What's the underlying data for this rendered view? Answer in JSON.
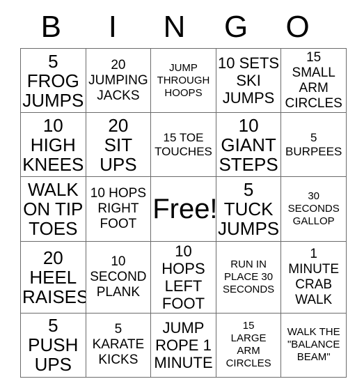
{
  "card": {
    "title": "BINGO",
    "header_letters": [
      "B",
      "I",
      "N",
      "G",
      "O"
    ],
    "free_space_label": "Free!",
    "grid_line_color": "#6b6b6b",
    "text_color": "#000000",
    "background_color": "#ffffff"
  },
  "cells": [
    [
      {
        "lines": [
          "5",
          "FROG",
          "JUMPS"
        ],
        "size": "s26"
      },
      {
        "lines": [
          "20",
          "JUMPING",
          "JACKS"
        ],
        "size": "s19"
      },
      {
        "lines": [
          "JUMP",
          "THROUGH",
          "HOOPS"
        ],
        "size": "s15"
      },
      {
        "lines": [
          "10 SETS",
          "SKI",
          "JUMPS"
        ],
        "size": "s22"
      },
      {
        "lines": [
          "15 SMALL",
          "ARM",
          "CIRCLES"
        ],
        "size": "s19"
      }
    ],
    [
      {
        "lines": [
          "10",
          "HIGH",
          "KNEES"
        ],
        "size": "s26"
      },
      {
        "lines": [
          "20",
          "SIT",
          "UPS"
        ],
        "size": "s26"
      },
      {
        "lines": [
          "15 TOE",
          "TOUCHES"
        ],
        "size": "s17"
      },
      {
        "lines": [
          "10",
          "GIANT",
          "STEPS"
        ],
        "size": "s26"
      },
      {
        "lines": [
          "5",
          "BURPEES"
        ],
        "size": "s17"
      }
    ],
    [
      {
        "lines": [
          "WALK",
          "ON TIP",
          "TOES"
        ],
        "size": "s26"
      },
      {
        "lines": [
          "10 HOPS",
          "RIGHT",
          "FOOT"
        ],
        "size": "s19"
      },
      {
        "lines": [
          "Free!"
        ],
        "size": "s40",
        "free": true
      },
      {
        "lines": [
          "5",
          "TUCK",
          "JUMPS"
        ],
        "size": "s26"
      },
      {
        "lines": [
          "30",
          "SECONDS",
          "GALLOP"
        ],
        "size": "s15"
      }
    ],
    [
      {
        "lines": [
          "20",
          "HEEL",
          "RAISES"
        ],
        "size": "s26"
      },
      {
        "lines": [
          "10",
          "SECOND",
          "PLANK"
        ],
        "size": "s19"
      },
      {
        "lines": [
          "10 HOPS",
          "LEFT",
          "FOOT"
        ],
        "size": "s22"
      },
      {
        "lines": [
          "RUN IN",
          "PLACE 30",
          "SECONDS"
        ],
        "size": "s15"
      },
      {
        "lines": [
          "1 MINUTE",
          "CRAB",
          "WALK"
        ],
        "size": "s19"
      }
    ],
    [
      {
        "lines": [
          "5",
          "PUSH",
          "UPS"
        ],
        "size": "s26"
      },
      {
        "lines": [
          "5",
          "KARATE",
          "KICKS"
        ],
        "size": "s19"
      },
      {
        "lines": [
          "JUMP",
          "ROPE 1",
          "MINUTE"
        ],
        "size": "s22"
      },
      {
        "lines": [
          "15",
          "LARGE",
          "ARM",
          "CIRCLES"
        ],
        "size": "s15"
      },
      {
        "lines": [
          "WALK THE",
          "\"BALANCE",
          "BEAM\""
        ],
        "size": "s15"
      }
    ]
  ]
}
